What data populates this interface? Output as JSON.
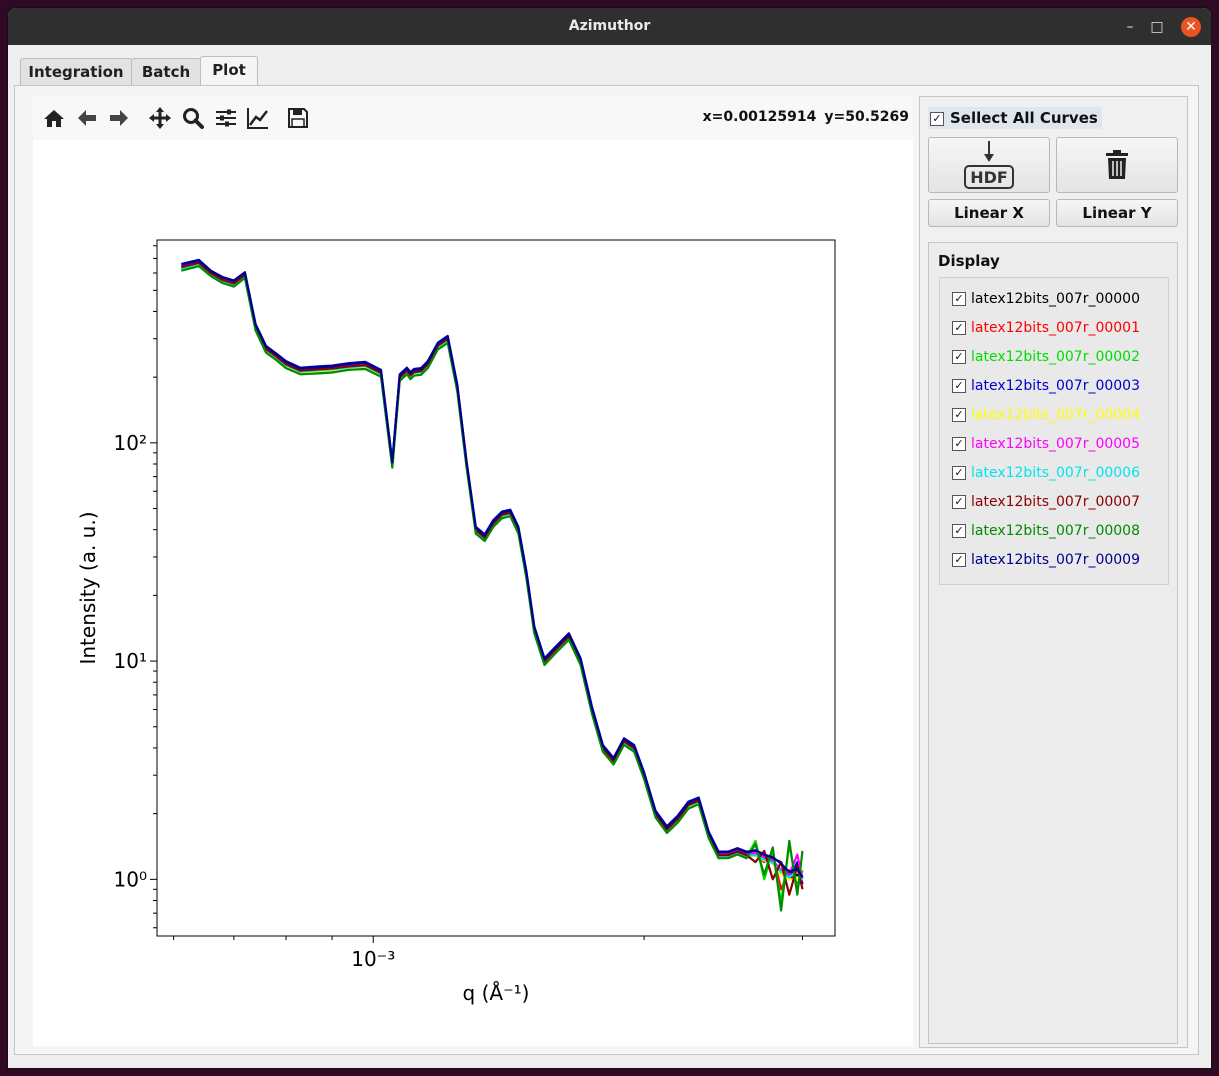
{
  "window": {
    "title": "Azimuthor"
  },
  "titlebar_buttons": {
    "minimize": "–",
    "maximize": "□",
    "close": "✕"
  },
  "tabs": [
    {
      "label": "Integration",
      "active": false
    },
    {
      "label": "Batch",
      "active": false
    },
    {
      "label": "Plot",
      "active": true
    }
  ],
  "toolbar": {
    "icons": [
      "home-icon",
      "back-arrow-icon",
      "forward-arrow-icon",
      "pan-icon",
      "zoom-icon",
      "configure-subplots-icon",
      "edit-axis-icon",
      "save-icon"
    ],
    "coord_x": "x=0.00125914",
    "coord_y": "y=50.5269"
  },
  "sidepanel": {
    "select_all_label": "Sellect All Curves",
    "select_all_checked": true,
    "hdf_button_text": "HDF",
    "linear_x_label": "Linear X",
    "linear_y_label": "Linear Y",
    "display_title": "Display",
    "curves": [
      {
        "name": "latex12bits_007r_00000",
        "color": "#000000",
        "checked": true
      },
      {
        "name": "latex12bits_007r_00001",
        "color": "#ff0000",
        "checked": true
      },
      {
        "name": "latex12bits_007r_00002",
        "color": "#00dd00",
        "checked": true
      },
      {
        "name": "latex12bits_007r_00003",
        "color": "#0000cc",
        "checked": true
      },
      {
        "name": "latex12bits_007r_00004",
        "color": "#ffff00",
        "checked": true
      },
      {
        "name": "latex12bits_007r_00005",
        "color": "#ff00ff",
        "checked": true
      },
      {
        "name": "latex12bits_007r_00006",
        "color": "#00e5ee",
        "checked": true
      },
      {
        "name": "latex12bits_007r_00007",
        "color": "#8b0000",
        "checked": true
      },
      {
        "name": "latex12bits_007r_00008",
        "color": "#008b00",
        "checked": true
      },
      {
        "name": "latex12bits_007r_00009",
        "color": "#00008b",
        "checked": true
      }
    ]
  },
  "chart_data": {
    "type": "line",
    "xscale": "log",
    "yscale": "log",
    "xlabel": "q (Å⁻¹)",
    "ylabel": "Intensity (a. u.)",
    "x_tick_labels": [
      {
        "value": 0.001,
        "label": "10⁻³"
      }
    ],
    "y_tick_labels": [
      {
        "value": 1,
        "label": "10⁰"
      },
      {
        "value": 10,
        "label": "10¹"
      },
      {
        "value": 100,
        "label": "10²"
      }
    ],
    "xlim": [
      0.000575,
      0.00326
    ],
    "ylim": [
      0.55,
      850
    ],
    "x": [
      0.000612,
      0.00064,
      0.00066,
      0.00068,
      0.0007,
      0.00072,
      0.00074,
      0.00076,
      0.00078,
      0.0008,
      0.00083,
      0.00087,
      0.0009,
      0.00094,
      0.00098,
      0.00102,
      0.00105,
      0.00107,
      0.00109,
      0.0011,
      0.00111,
      0.00113,
      0.00115,
      0.00118,
      0.00121,
      0.00124,
      0.00127,
      0.0013,
      0.00133,
      0.00136,
      0.00139,
      0.00142,
      0.00145,
      0.00148,
      0.00151,
      0.00155,
      0.0016,
      0.00165,
      0.0017,
      0.00175,
      0.0018,
      0.00185,
      0.0019,
      0.00195,
      0.002,
      0.00206,
      0.00212,
      0.00218,
      0.00224,
      0.0023,
      0.00236,
      0.00242,
      0.00248,
      0.00254,
      0.0026,
      0.00266,
      0.00272,
      0.00278,
      0.00284,
      0.0029,
      0.00296,
      0.003
    ],
    "series": [
      {
        "color": "#000000",
        "values": [
          640,
          670,
          600,
          560,
          540,
          590,
          340,
          270,
          250,
          230,
          215,
          218,
          220,
          225,
          228,
          210,
          80,
          200,
          215,
          205,
          212,
          214,
          230,
          280,
          300,
          180,
          80,
          40,
          37,
          43,
          47,
          48,
          40,
          25,
          14,
          10,
          11.5,
          13,
          10,
          6,
          4,
          3.5,
          4.3,
          4,
          3,
          2,
          1.7,
          1.9,
          2.2,
          2.3,
          1.6,
          1.3,
          1.3,
          1.35,
          1.3,
          1.3,
          1.25,
          1.2,
          1.1,
          1.0,
          1.05,
          1.0
        ]
      },
      {
        "color": "#ff0000",
        "values": [
          635,
          665,
          595,
          555,
          535,
          585,
          338,
          268,
          248,
          228,
          213,
          216,
          218,
          223,
          226,
          208,
          79,
          198,
          213,
          203,
          210,
          212,
          228,
          278,
          298,
          178,
          79,
          39.6,
          36.6,
          42.6,
          46.5,
          47.5,
          39.6,
          24.8,
          13.9,
          9.9,
          11.4,
          12.9,
          9.9,
          5.9,
          3.96,
          3.46,
          4.26,
          3.96,
          2.97,
          1.98,
          1.68,
          1.88,
          2.18,
          2.28,
          1.58,
          1.28,
          1.28,
          1.34,
          1.28,
          1.3,
          1.2,
          1.3,
          0.9,
          1.1,
          0.95,
          1.05
        ]
      },
      {
        "color": "#00dd00",
        "values": [
          620,
          650,
          585,
          545,
          525,
          575,
          330,
          262,
          242,
          222,
          208,
          210,
          212,
          218,
          220,
          203,
          78,
          194,
          208,
          198,
          205,
          207,
          222,
          270,
          290,
          174,
          78,
          38.8,
          35.9,
          41.7,
          45.6,
          46.6,
          38.8,
          24.3,
          13.6,
          9.7,
          11.2,
          12.6,
          9.7,
          5.8,
          3.9,
          3.4,
          4.2,
          3.9,
          2.9,
          1.94,
          1.65,
          1.84,
          2.13,
          2.23,
          1.55,
          1.26,
          1.26,
          1.31,
          1.26,
          1.5,
          1.0,
          1.35,
          0.78,
          1.45,
          0.9,
          1.1
        ]
      },
      {
        "color": "#0000cc",
        "values": [
          660,
          690,
          615,
          575,
          555,
          605,
          350,
          278,
          257,
          237,
          221,
          224,
          226,
          232,
          235,
          216,
          82,
          206,
          221,
          211,
          218,
          220,
          237,
          288,
          309,
          185,
          82,
          41.2,
          38.1,
          44.3,
          48.4,
          49.4,
          41.2,
          25.8,
          14.4,
          10.3,
          11.8,
          13.4,
          10.3,
          6.2,
          4.12,
          3.6,
          4.43,
          4.12,
          3.09,
          2.06,
          1.75,
          1.96,
          2.27,
          2.37,
          1.65,
          1.34,
          1.34,
          1.39,
          1.34,
          1.35,
          1.29,
          1.25,
          1.2,
          1.0,
          1.2,
          0.95
        ]
      },
      {
        "color": "#ffff00",
        "values": [
          625,
          655,
          590,
          550,
          530,
          580,
          333,
          265,
          245,
          225,
          210,
          213,
          215,
          220,
          223,
          205,
          78.5,
          196,
          210,
          200,
          207,
          209,
          225,
          274,
          294,
          176,
          78.5,
          39.2,
          36.3,
          42.1,
          46.1,
          47,
          39.2,
          24.5,
          13.7,
          9.8,
          11.3,
          12.7,
          9.8,
          5.9,
          3.92,
          3.43,
          4.21,
          3.92,
          2.94,
          1.96,
          1.67,
          1.86,
          2.16,
          2.25,
          1.57,
          1.27,
          1.27,
          1.32,
          1.27,
          1.28,
          1.22,
          1.18,
          1.05,
          1.0,
          1.0,
          1.0
        ]
      },
      {
        "color": "#ff00ff",
        "values": [
          645,
          675,
          605,
          565,
          545,
          595,
          343,
          272,
          252,
          232,
          217,
          220,
          222,
          227,
          230,
          212,
          80.5,
          202,
          217,
          207,
          214,
          216,
          232,
          283,
          303,
          182,
          80.5,
          40.4,
          37.4,
          43.4,
          47.5,
          48.5,
          40.4,
          25.3,
          14.1,
          10.1,
          11.6,
          13.1,
          10.1,
          6.1,
          4.04,
          3.54,
          4.34,
          4.04,
          3.03,
          2.02,
          1.72,
          1.92,
          2.22,
          2.32,
          1.62,
          1.31,
          1.31,
          1.36,
          1.31,
          1.32,
          1.26,
          1.22,
          1.1,
          1.05,
          1.3,
          1.0
        ]
      },
      {
        "color": "#00e5ee",
        "values": [
          630,
          660,
          592,
          552,
          532,
          582,
          336,
          266,
          247,
          227,
          212,
          215,
          217,
          222,
          225,
          207,
          79,
          197,
          212,
          202,
          209,
          211,
          227,
          276,
          296,
          177,
          79,
          39.4,
          36.5,
          42.4,
          46.3,
          47.3,
          39.4,
          24.6,
          13.8,
          9.85,
          11.3,
          12.8,
          9.85,
          5.9,
          3.94,
          3.45,
          4.24,
          3.94,
          2.96,
          1.97,
          1.67,
          1.87,
          2.17,
          2.27,
          1.58,
          1.28,
          1.28,
          1.33,
          1.28,
          1.29,
          1.23,
          1.19,
          1.08,
          1.02,
          1.1,
          1.0
        ]
      },
      {
        "color": "#8b0000",
        "values": [
          638,
          668,
          598,
          558,
          538,
          588,
          339,
          269,
          249,
          229,
          214,
          217,
          219,
          224,
          227,
          209,
          79.5,
          199,
          214,
          204,
          211,
          213,
          229,
          279,
          299,
          179,
          79.5,
          39.8,
          36.8,
          42.8,
          46.8,
          47.8,
          39.8,
          24.9,
          14,
          9.95,
          11.45,
          12.95,
          9.95,
          5.97,
          3.98,
          3.48,
          4.28,
          3.98,
          2.99,
          1.99,
          1.69,
          1.89,
          2.19,
          2.29,
          1.59,
          1.29,
          1.29,
          1.34,
          1.29,
          1.2,
          1.35,
          1.0,
          1.2,
          0.85,
          1.15,
          0.9
        ]
      },
      {
        "color": "#008b00",
        "values": [
          615,
          645,
          580,
          540,
          520,
          570,
          327,
          259,
          240,
          220,
          206,
          208,
          210,
          216,
          218,
          201,
          77,
          192,
          206,
          196,
          203,
          205,
          220,
          268,
          287,
          172,
          77,
          38.4,
          35.5,
          41.3,
          45.1,
          46.1,
          38.4,
          24,
          13.4,
          9.6,
          11.04,
          12.5,
          9.6,
          5.76,
          3.84,
          3.36,
          4.13,
          3.84,
          2.88,
          1.92,
          1.63,
          1.82,
          2.11,
          2.21,
          1.54,
          1.25,
          1.25,
          1.3,
          1.25,
          1.45,
          1.05,
          1.4,
          0.72,
          1.5,
          0.85,
          1.35
        ]
      },
      {
        "color": "#00008b",
        "values": [
          655,
          685,
          612,
          572,
          552,
          602,
          347,
          276,
          255,
          235,
          219,
          222,
          224,
          230,
          233,
          214,
          81.5,
          204,
          219,
          209,
          216,
          218,
          235,
          286,
          306,
          183,
          81.5,
          40.8,
          37.7,
          43.9,
          47.9,
          48.9,
          40.8,
          25.5,
          14.3,
          10.2,
          11.7,
          13.3,
          10.2,
          6.12,
          4.08,
          3.57,
          4.39,
          4.08,
          3.06,
          2.04,
          1.73,
          1.94,
          2.24,
          2.35,
          1.63,
          1.33,
          1.33,
          1.38,
          1.33,
          1.36,
          1.3,
          1.26,
          1.18,
          1.08,
          1.12,
          1.02
        ]
      }
    ]
  }
}
